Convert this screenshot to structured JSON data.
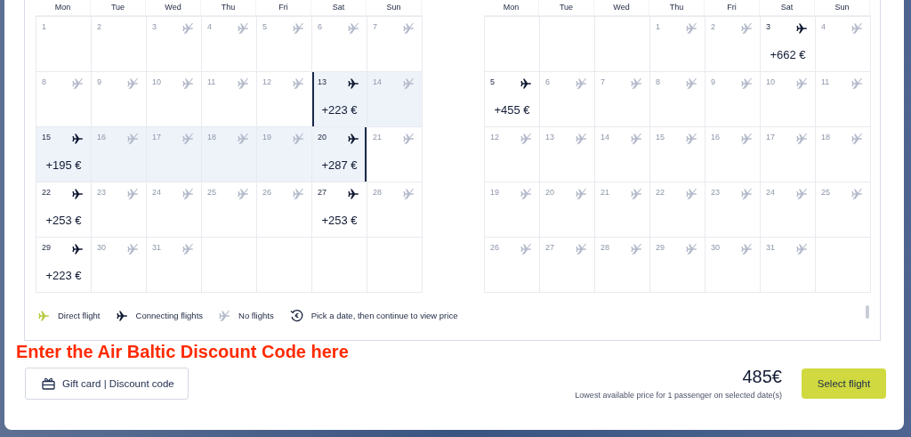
{
  "months": [
    {
      "weekdays": [
        "Mon",
        "Tue",
        "Wed",
        "Thu",
        "Fri",
        "Sat",
        "Sun"
      ],
      "weeks": [
        [
          {
            "day": "1",
            "kind": "unavailable",
            "in_range": false,
            "range_start": false,
            "range_end": false
          },
          {
            "day": "2",
            "kind": "unavailable",
            "in_range": false,
            "range_start": false,
            "range_end": false
          },
          {
            "day": "3",
            "kind": "none",
            "in_range": false,
            "range_start": false,
            "range_end": false
          },
          {
            "day": "4",
            "kind": "none",
            "in_range": false,
            "range_start": false,
            "range_end": false
          },
          {
            "day": "5",
            "kind": "none",
            "in_range": false,
            "range_start": false,
            "range_end": false
          },
          {
            "day": "6",
            "kind": "none",
            "in_range": false,
            "range_start": false,
            "range_end": false
          },
          {
            "day": "7",
            "kind": "none",
            "in_range": false,
            "range_start": false,
            "range_end": false
          }
        ],
        [
          {
            "day": "8",
            "kind": "none",
            "in_range": false,
            "range_start": false,
            "range_end": false
          },
          {
            "day": "9",
            "kind": "none",
            "in_range": false,
            "range_start": false,
            "range_end": false
          },
          {
            "day": "10",
            "kind": "none",
            "in_range": false,
            "range_start": false,
            "range_end": false
          },
          {
            "day": "11",
            "kind": "none",
            "in_range": false,
            "range_start": false,
            "range_end": false
          },
          {
            "day": "12",
            "kind": "none",
            "in_range": false,
            "range_start": false,
            "range_end": false
          },
          {
            "day": "13",
            "kind": "connecting",
            "price": "+223 €",
            "in_range": true,
            "range_start": true,
            "range_end": false
          },
          {
            "day": "14",
            "kind": "none",
            "in_range": true,
            "range_start": false,
            "range_end": false
          }
        ],
        [
          {
            "day": "15",
            "kind": "connecting",
            "price": "+195 €",
            "in_range": true,
            "range_start": false,
            "range_end": false
          },
          {
            "day": "16",
            "kind": "none",
            "in_range": true,
            "range_start": false,
            "range_end": false
          },
          {
            "day": "17",
            "kind": "none",
            "in_range": true,
            "range_start": false,
            "range_end": false
          },
          {
            "day": "18",
            "kind": "none",
            "in_range": true,
            "range_start": false,
            "range_end": false
          },
          {
            "day": "19",
            "kind": "none",
            "in_range": true,
            "range_start": false,
            "range_end": false
          },
          {
            "day": "20",
            "kind": "connecting",
            "price": "+287 €",
            "in_range": true,
            "range_start": false,
            "range_end": true
          },
          {
            "day": "21",
            "kind": "none",
            "in_range": false,
            "range_start": false,
            "range_end": false
          }
        ],
        [
          {
            "day": "22",
            "kind": "connecting",
            "price": "+253 €",
            "in_range": false,
            "range_start": false,
            "range_end": false
          },
          {
            "day": "23",
            "kind": "none",
            "in_range": false,
            "range_start": false,
            "range_end": false
          },
          {
            "day": "24",
            "kind": "none",
            "in_range": false,
            "range_start": false,
            "range_end": false
          },
          {
            "day": "25",
            "kind": "none",
            "in_range": false,
            "range_start": false,
            "range_end": false
          },
          {
            "day": "26",
            "kind": "none",
            "in_range": false,
            "range_start": false,
            "range_end": false
          },
          {
            "day": "27",
            "kind": "connecting",
            "price": "+253 €",
            "in_range": false,
            "range_start": false,
            "range_end": false
          },
          {
            "day": "28",
            "kind": "none",
            "in_range": false,
            "range_start": false,
            "range_end": false
          }
        ],
        [
          {
            "day": "29",
            "kind": "connecting",
            "price": "+223 €",
            "in_range": false,
            "range_start": false,
            "range_end": false
          },
          {
            "day": "30",
            "kind": "none",
            "in_range": false,
            "range_start": false,
            "range_end": false
          },
          {
            "day": "31",
            "kind": "none",
            "in_range": false,
            "range_start": false,
            "range_end": false
          },
          {
            "kind": "empty"
          },
          {
            "kind": "empty"
          },
          {
            "kind": "empty"
          },
          {
            "kind": "empty"
          }
        ]
      ]
    },
    {
      "weekdays": [
        "Mon",
        "Tue",
        "Wed",
        "Thu",
        "Fri",
        "Sat",
        "Sun"
      ],
      "weeks": [
        [
          {
            "kind": "empty"
          },
          {
            "kind": "empty"
          },
          {
            "kind": "empty"
          },
          {
            "day": "1",
            "kind": "none",
            "in_range": false,
            "range_start": false,
            "range_end": false
          },
          {
            "day": "2",
            "kind": "none",
            "in_range": false,
            "range_start": false,
            "range_end": false
          },
          {
            "day": "3",
            "kind": "connecting",
            "price": "+662 €",
            "in_range": false,
            "range_start": false,
            "range_end": false
          },
          {
            "day": "4",
            "kind": "none",
            "in_range": false,
            "range_start": false,
            "range_end": false
          }
        ],
        [
          {
            "day": "5",
            "kind": "connecting",
            "price": "+455 €",
            "in_range": false,
            "range_start": false,
            "range_end": false
          },
          {
            "day": "6",
            "kind": "none",
            "in_range": false,
            "range_start": false,
            "range_end": false
          },
          {
            "day": "7",
            "kind": "none",
            "in_range": false,
            "range_start": false,
            "range_end": false
          },
          {
            "day": "8",
            "kind": "none",
            "in_range": false,
            "range_start": false,
            "range_end": false
          },
          {
            "day": "9",
            "kind": "none",
            "in_range": false,
            "range_start": false,
            "range_end": false
          },
          {
            "day": "10",
            "kind": "none",
            "in_range": false,
            "range_start": false,
            "range_end": false
          },
          {
            "day": "11",
            "kind": "none",
            "in_range": false,
            "range_start": false,
            "range_end": false
          }
        ],
        [
          {
            "day": "12",
            "kind": "none",
            "in_range": false,
            "range_start": false,
            "range_end": false
          },
          {
            "day": "13",
            "kind": "none",
            "in_range": false,
            "range_start": false,
            "range_end": false
          },
          {
            "day": "14",
            "kind": "none",
            "in_range": false,
            "range_start": false,
            "range_end": false
          },
          {
            "day": "15",
            "kind": "none",
            "in_range": false,
            "range_start": false,
            "range_end": false
          },
          {
            "day": "16",
            "kind": "none",
            "in_range": false,
            "range_start": false,
            "range_end": false
          },
          {
            "day": "17",
            "kind": "none",
            "in_range": false,
            "range_start": false,
            "range_end": false
          },
          {
            "day": "18",
            "kind": "none",
            "in_range": false,
            "range_start": false,
            "range_end": false
          }
        ],
        [
          {
            "day": "19",
            "kind": "none",
            "in_range": false,
            "range_start": false,
            "range_end": false
          },
          {
            "day": "20",
            "kind": "none",
            "in_range": false,
            "range_start": false,
            "range_end": false
          },
          {
            "day": "21",
            "kind": "none",
            "in_range": false,
            "range_start": false,
            "range_end": false
          },
          {
            "day": "22",
            "kind": "none",
            "in_range": false,
            "range_start": false,
            "range_end": false
          },
          {
            "day": "23",
            "kind": "none",
            "in_range": false,
            "range_start": false,
            "range_end": false
          },
          {
            "day": "24",
            "kind": "none",
            "in_range": false,
            "range_start": false,
            "range_end": false
          },
          {
            "day": "25",
            "kind": "none",
            "in_range": false,
            "range_start": false,
            "range_end": false
          }
        ],
        [
          {
            "day": "26",
            "kind": "none",
            "in_range": false,
            "range_start": false,
            "range_end": false
          },
          {
            "day": "27",
            "kind": "none",
            "in_range": false,
            "range_start": false,
            "range_end": false
          },
          {
            "day": "28",
            "kind": "none",
            "in_range": false,
            "range_start": false,
            "range_end": false
          },
          {
            "day": "29",
            "kind": "none",
            "in_range": false,
            "range_start": false,
            "range_end": false
          },
          {
            "day": "30",
            "kind": "none",
            "in_range": false,
            "range_start": false,
            "range_end": false
          },
          {
            "day": "31",
            "kind": "none",
            "in_range": false,
            "range_start": false,
            "range_end": false
          },
          {
            "kind": "empty"
          }
        ]
      ]
    }
  ],
  "legend": [
    {
      "kind": "direct",
      "label": "Direct flight"
    },
    {
      "kind": "connecting",
      "label": "Connecting flights"
    },
    {
      "kind": "none",
      "label": "No flights"
    },
    {
      "kind": "price",
      "label": "Pick a date, then continue to view price"
    }
  ],
  "annotation": "Enter the Air Baltic Discount Code here",
  "gift_button": "Gift card | Discount code",
  "price": "485€",
  "price_note": "Lowest available price for 1 passenger on selected date(s)",
  "select_button": "Select flight"
}
